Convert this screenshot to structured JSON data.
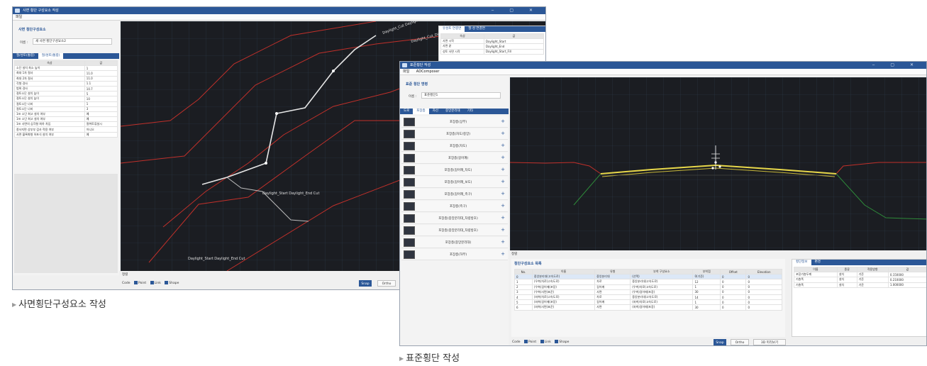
{
  "window1": {
    "title": "사면 횡단 구성요소 작성",
    "menu": [
      "파일"
    ],
    "section_title": "사면 횡단구성요소",
    "name_label": "이름 :",
    "name_value": "새 사면 횡단구성요소2",
    "tabs": [
      "절/성토(통합)",
      "절/성토(통합)"
    ],
    "prop_headers": [
      "속성",
      "값"
    ],
    "props": [
      [
        "소단 설치 최소 높이",
        "1"
      ],
      [
        "최대 1차 절사",
        "11.0"
      ],
      [
        "최대 2차 절사",
        "11.0"
      ],
      [
        "각형 경사",
        "1.1"
      ],
      [
        "범위 경사",
        "10.7"
      ],
      [
        "절토소단 설치 높이",
        "5"
      ],
      [
        "절토소단 설치 높이",
        "10"
      ],
      [
        "절토소단 너비",
        "1"
      ],
      [
        "절토소단 너비",
        "3"
      ],
      [
        "1m 소단 최고 설치 여부",
        "예"
      ],
      [
        "1m 소단 최고 설치 여부",
        "예"
      ],
      [
        "1m 사면의 심각형 최하 차입",
        "절취토류설시"
      ],
      [
        "종사지면 상부부 검사 적용 여부",
        "아니오"
      ],
      [
        "사면 블록화형 하포식 설치 여부",
        "예"
      ]
    ],
    "right_tabs": [
      "유성토 연결면",
      "절·성 연결면"
    ],
    "right_headers": [
      "속성",
      "값"
    ],
    "right_rows": [
      [
        "사면 시작",
        "Daylight_Start"
      ],
      [
        "사면 끝",
        "Daylight_End"
      ],
      [
        "성토 사면 시작",
        "Daylight_Start_Fill"
      ]
    ],
    "canvas_labels": [
      "Daylight_Start Daylight_End Cut",
      "Daylight_Cut Daylight",
      "Daylight_Cut_Ditch Daylight",
      "Daylight_Start Daylight_End Cut"
    ],
    "status_label": "정렬",
    "status_code": "Code",
    "status_checks": [
      "Point",
      "Link",
      "Shape"
    ],
    "snap": "Snap",
    "ortho": "Ortho"
  },
  "window2": {
    "title": "표준횡단 작성",
    "menu": [
      "파일",
      "ADComposer"
    ],
    "section_title": "표준 횡단 명령",
    "name_label": "이름 :",
    "name_value": "표준횡단1",
    "tabs": [
      "도로",
      "포장층",
      "차선",
      "중앙분리대",
      "기타"
    ],
    "list_items": [
      "포장층(상부)",
      "포장층(차도/중앙)",
      "포장층(차도)",
      "포장층(길어깨)",
      "포장층(길어깨_차도)",
      "포장층(길어깨_보도)",
      "포장층(길어깨_측구)",
      "포장층(측구)",
      "포장층(중앙분리대_차량방호)",
      "포장층(중앙분리대_차량방호)",
      "포장층(중앙분리대)",
      "포장층(하부)"
    ],
    "canvas_status": "정렬",
    "table_title": "횡단구성요소 목록",
    "table_headers": [
      "No.",
      "이름",
      "유형",
      "부착 구성요소",
      "부착점",
      "Offset",
      "Elevation"
    ],
    "table_rows": [
      [
        "0",
        "중앙분리대(고속도로)",
        "중앙분리대",
        "(선택)",
        "0(기준)",
        "0",
        "0"
      ],
      [
        "1",
        "(우측)차로(고속도로)",
        "차로",
        "중앙분리대(고속도로)",
        "12",
        "0",
        "0"
      ],
      [
        "2",
        "(우측)길어깨(포장)",
        "길어깨",
        "(우측)차로(고속도로)",
        "1",
        "0",
        "0"
      ],
      [
        "3",
        "(우측)사면(표준)",
        "사면",
        "(우측)길어깨(포장)",
        "30",
        "0",
        "0"
      ],
      [
        "4",
        "(좌측)차로(고속도로)",
        "차로",
        "중앙분리대(고속도로)",
        "14",
        "0",
        "0"
      ],
      [
        "5",
        "(좌측)길어깨(포장)",
        "길어깨",
        "(좌측)차로(고속도로)",
        "1",
        "0",
        "0"
      ],
      [
        "6",
        "(좌측)사면(표준)",
        "사면",
        "(좌측)길어깨(포장)",
        "30",
        "0",
        "0"
      ]
    ],
    "side_tabs": [
      "횡단정보",
      "편경"
    ],
    "side_headers": [
      "이름",
      "종류",
      "적용방향",
      "값"
    ],
    "side_rows": [
      [
        "포장기층두께",
        "설치",
        "기준",
        "0.150000"
      ],
      [
        "기층폭",
        "설치",
        "기준",
        "0.210000"
      ],
      [
        "기층폭",
        "설치",
        "기준",
        "1.000000"
      ]
    ],
    "status_code": "Code",
    "status_checks": [
      "Point",
      "Link",
      "Shape"
    ],
    "snap": "Snap",
    "ortho": "Ortho",
    "view_button": "3D 미리보기"
  },
  "captions": {
    "left": "사면횡단구성요소 작성",
    "right": "표준횡단 작성"
  },
  "colors": {
    "accent": "#2b5797",
    "canvas_bg": "#1b1d22",
    "grid": "#2c3a4a",
    "red_line": "#c0302a",
    "green_line": "#2e8b3a",
    "yellow": "#e8d84a"
  }
}
